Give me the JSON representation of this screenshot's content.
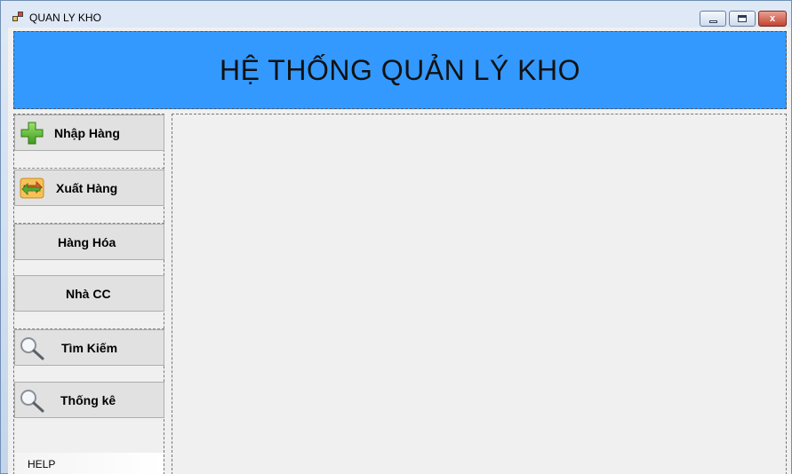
{
  "window": {
    "title": "QUAN LY KHO",
    "minimize_label": "",
    "maximize_label": "",
    "close_label": "x"
  },
  "header": {
    "title": "HỆ THỐNG QUẢN LÝ KHO",
    "background": "#3399ff"
  },
  "sidebar": {
    "items": [
      {
        "label": "Nhập Hàng",
        "icon": "plus-icon"
      },
      {
        "label": "Xuất Hàng",
        "icon": "exchange-icon"
      },
      {
        "label": "Hàng Hóa",
        "icon": ""
      },
      {
        "label": "Nhà CC",
        "icon": ""
      },
      {
        "label": "Tìm Kiếm",
        "icon": "magnifier-icon"
      },
      {
        "label": "Thống kê",
        "icon": "magnifier-icon"
      }
    ],
    "help_label": "HELP"
  }
}
